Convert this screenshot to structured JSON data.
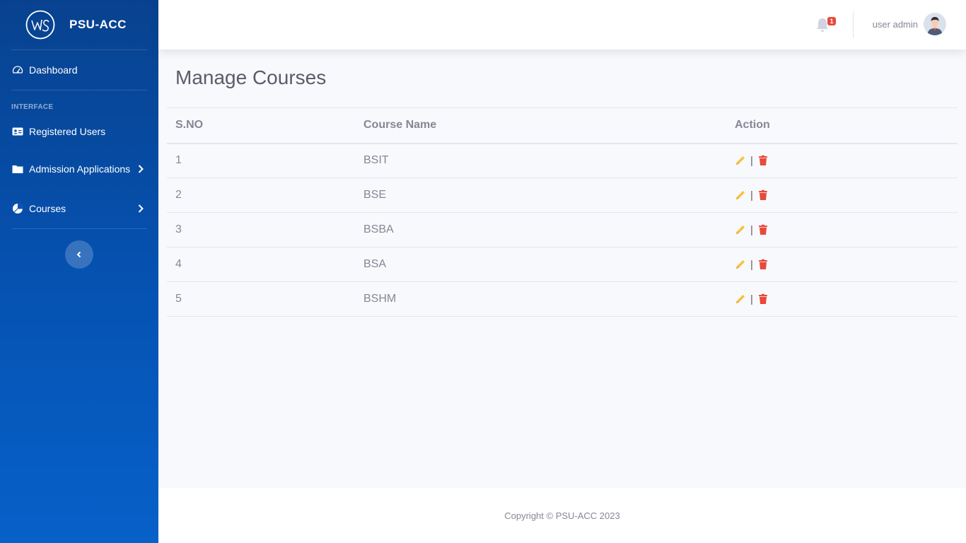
{
  "brand": {
    "name": "PSU-ACC"
  },
  "sidebar": {
    "items": [
      {
        "label": "Dashboard",
        "icon": "tachometer-icon"
      },
      {
        "label": "Registered Users",
        "icon": "id-card-icon"
      },
      {
        "label": "Admission Applications",
        "icon": "folder-icon"
      },
      {
        "label": "Courses",
        "icon": "pie-chart-icon"
      }
    ],
    "heading": "INTERFACE"
  },
  "topbar": {
    "notification_count": "1",
    "user_name": "user admin"
  },
  "page": {
    "title": "Manage Courses"
  },
  "table": {
    "headers": [
      "S.NO",
      "Course Name",
      "Action"
    ],
    "rows": [
      {
        "sno": "1",
        "course": "BSIT"
      },
      {
        "sno": "2",
        "course": "BSE"
      },
      {
        "sno": "3",
        "course": "BSBA"
      },
      {
        "sno": "4",
        "course": "BSA"
      },
      {
        "sno": "5",
        "course": "BSHM"
      }
    ],
    "separator": "|"
  },
  "footer": {
    "copyright": "Copyright © PSU-ACC 2023"
  },
  "colors": {
    "edit": "#f6c23e",
    "delete": "#e74a3b",
    "sidebar": "#0553b3"
  }
}
